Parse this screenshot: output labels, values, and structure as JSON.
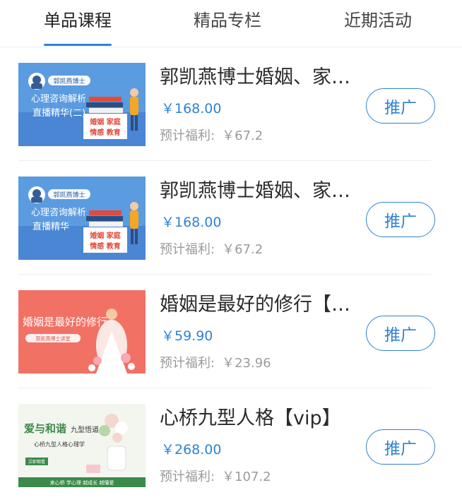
{
  "tabs": [
    "单品课程",
    "精品专栏",
    "近期活动"
  ],
  "colors": {
    "accent": "#2f82d6",
    "text": "#2b2b2b",
    "muted": "#9b9b9b"
  },
  "courses": [
    {
      "title": "郭凯燕博士婚姻、家…",
      "price": "￥168.00",
      "welfare_label": "预计福利:",
      "welfare_value": "￥67.2",
      "action": "推广",
      "thumb": {
        "type": "blue",
        "name_text": "郭凯燕博士",
        "subtitle": "心理咨询解析",
        "subtitle2": "直播精华(二)",
        "tag1": "婚姻 家庭",
        "tag2": "情感 教育"
      }
    },
    {
      "title": "郭凯燕博士婚姻、家…",
      "price": "￥168.00",
      "welfare_label": "预计福利:",
      "welfare_value": "￥67.2",
      "action": "推广",
      "thumb": {
        "type": "blue",
        "name_text": "郭凯燕博士",
        "subtitle": "心理咨询解析",
        "subtitle2": "直播精华",
        "tag1": "婚姻 家庭",
        "tag2": "情感 教育"
      }
    },
    {
      "title": "婚姻是最好的修行【…",
      "price": "￥59.90",
      "welfare_label": "预计福利:",
      "welfare_value": "￥23.96",
      "action": "推广",
      "thumb": {
        "type": "red",
        "headline": "婚姻是最好的修行",
        "sub": "郭凯燕博士讲堂"
      }
    },
    {
      "title": "心桥九型人格【vip】",
      "price": "￥268.00",
      "welfare_label": "预计福利:",
      "welfare_value": "￥107.2",
      "action": "推广",
      "thumb": {
        "type": "green",
        "headline": "爱与和谐",
        "headline2": "九型悟道",
        "sub": "心桥九型人格心理学",
        "footer": "来心桥 学心理 越成长 越懂爱",
        "badge": "立即观看"
      }
    }
  ]
}
